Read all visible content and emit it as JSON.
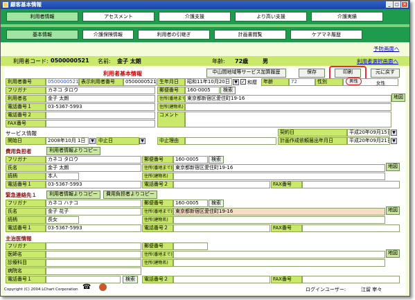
{
  "window": {
    "title": "顧客基本情報"
  },
  "nav1": [
    "利用者情報",
    "アセスメント",
    "介護支援",
    "より高い支援",
    "介護実績"
  ],
  "nav2": [
    "基本情報",
    "介護保険情報",
    "利用者の引継ぎ",
    "計画書閲覧",
    "ケアマネ履歴"
  ],
  "links": {
    "yobou": "予防画面へ",
    "select": "利用者選択画面へ"
  },
  "patient": {
    "code_label": "利用者コード:",
    "code": "0500000521",
    "name_label": "名前:",
    "name": "金子 太朗",
    "age_label": "年齢:",
    "age": "72歳",
    "sex": "男"
  },
  "panel": {
    "title": "利用者基本情報",
    "service_btn": "中山間地域等サービス加算履歴",
    "save": "保存",
    "print": "印刷",
    "back": "元に戻す"
  },
  "basic": {
    "lbl_no": "利用者番号",
    "no": "0500000521",
    "lbl_disp": "表示利用者番号",
    "disp": "0500000521",
    "lbl_birth": "生年月日",
    "birth": "昭和11年10月20日",
    "era": "和暦",
    "lbl_age": "年齢",
    "age": "72",
    "lbl_sex": "性別",
    "sex_m": "男性",
    "sex_f": "女性",
    "lbl_kana": "フリガナ",
    "kana": "カネコ タロウ",
    "lbl_zip": "郵便番号",
    "zip": "160-0005",
    "search": "検索",
    "lbl_name": "利用者名",
    "name": "金子 太朗",
    "lbl_addr1": "住所(番地まで)",
    "addr1": "東京都新宿区愛住町19-16",
    "map": "地図",
    "lbl_tel1": "電話番号１",
    "tel1": "03-5367-5993",
    "lbl_addr2": "住所(建物名)",
    "lbl_tel2": "電話番号２",
    "lbl_fax": "FAX番号",
    "lbl_comment": "コメント"
  },
  "service": {
    "title": "サービス情報",
    "lbl_contract": "契約日",
    "contract": "平成20年09月15日",
    "lbl_start": "開始日",
    "start": "2008年10月 1日",
    "lbl_stop": "中止日",
    "lbl_reason": "中止理由",
    "lbl_plan": "計画作成依頼届出年月日",
    "plan": "平成20年09月21日"
  },
  "payer": {
    "title": "費用負担者",
    "copy": "利用者情報よりコピー",
    "lbl_kana": "フリガナ",
    "kana": "カネコ タロウ",
    "lbl_zip": "郵便番号",
    "zip": "160-0005",
    "search": "検索",
    "lbl_name": "氏名",
    "name": "金子 太朗",
    "lbl_addr1": "住所(番地まで)",
    "addr1": "東京都新宿区愛住町19-16",
    "map": "地図",
    "lbl_rel": "続柄",
    "rel": "本人",
    "lbl_addr2": "住所(建物名)",
    "lbl_tel1": "電話番号１",
    "tel1": "03-5367-5993",
    "lbl_tel2": "電話番号２",
    "lbl_fax": "FAX番号"
  },
  "emergency": {
    "title": "緊急連絡先１",
    "copy": "利用者情報よりコピー",
    "copy2": "費用負担者よりコピー",
    "lbl_kana": "フリガナ",
    "kana": "カネコ ハナコ",
    "lbl_zip": "郵便番号",
    "zip": "160-0005",
    "search": "検索",
    "lbl_name": "氏名",
    "name": "金子 花子",
    "lbl_addr1": "住所(番地まで)",
    "addr1": "東京都新宿区愛住町19-16",
    "map": "地図",
    "lbl_rel": "続柄",
    "rel": "長女",
    "lbl_addr2": "住所(建物名)",
    "lbl_tel1": "電話番号１",
    "tel1": "03-5367-5993",
    "lbl_tel2": "電話番号２",
    "lbl_fax": "FAX番号"
  },
  "doctor": {
    "title": "主治医情報",
    "lbl_kana": "フリガナ",
    "lbl_zip": "郵便番号",
    "lbl_name": "医師名",
    "lbl_addr1": "住所(番地まで)",
    "map": "地図",
    "lbl_dept": "診療科目",
    "lbl_addr2": "住所(建物名)",
    "lbl_hosp": "病院名",
    "lbl_tel1": "電話番号１",
    "search": "検索",
    "lbl_tel2": "電話番号２",
    "lbl_fax": "FAX番号"
  },
  "footer": {
    "copyright": "Copyright (C) 2004 LChart Corporation",
    "login_label": "ログインユーザー:",
    "user": "江留 宰々"
  }
}
